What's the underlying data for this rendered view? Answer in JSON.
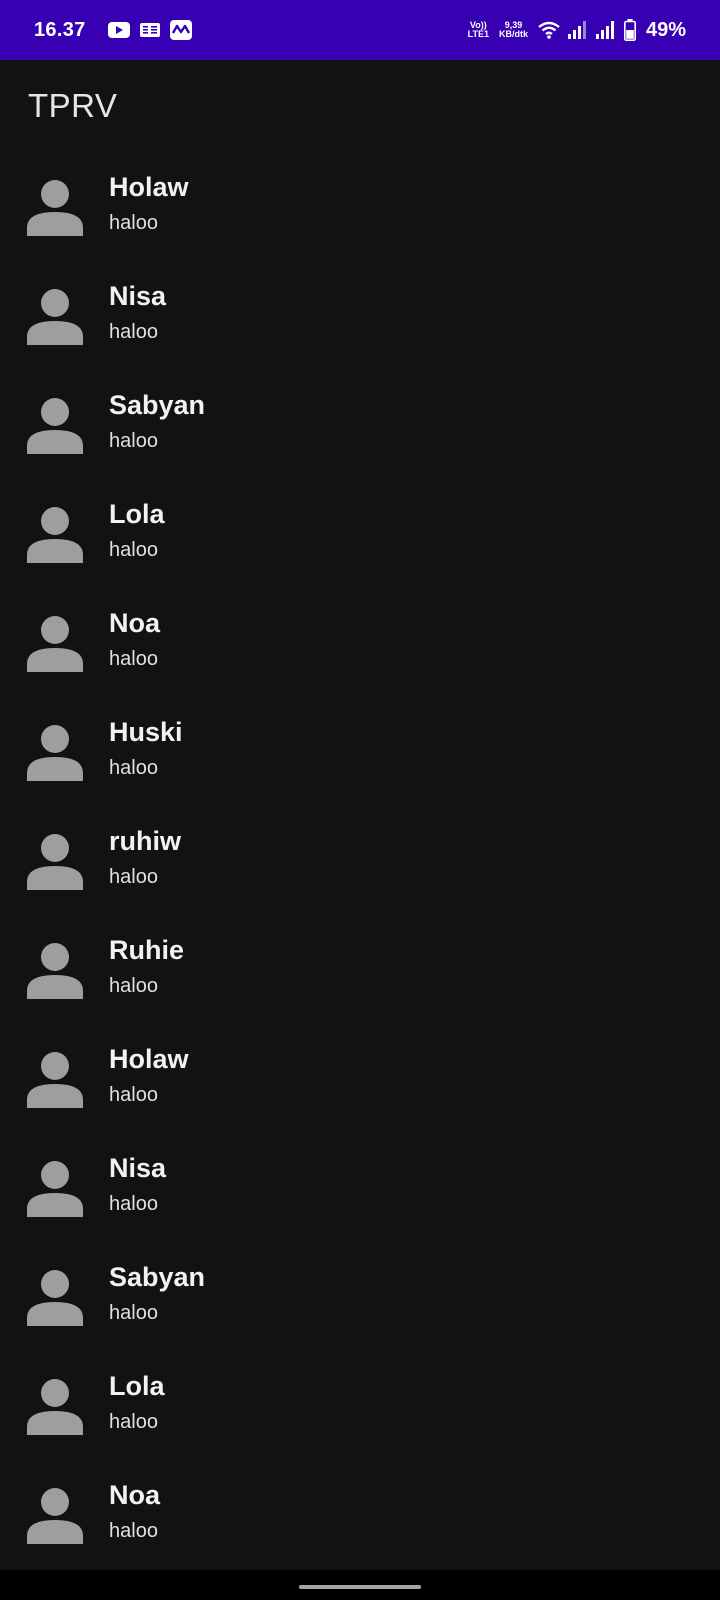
{
  "status_bar": {
    "time": "16.37",
    "notification_icons": [
      "youtube-icon",
      "ge-icon",
      "mail-icon"
    ],
    "volte_line1": "Vo))",
    "volte_line2": "LTE1",
    "speed_value": "9,39",
    "speed_unit": "KB/dtk",
    "battery_percent": "49%",
    "background_color": "#3700b3"
  },
  "app_bar": {
    "title": "TPRV"
  },
  "contacts": [
    {
      "name": "Holaw",
      "message": "haloo"
    },
    {
      "name": "Nisa",
      "message": "haloo"
    },
    {
      "name": "Sabyan",
      "message": "haloo"
    },
    {
      "name": "Lola",
      "message": "haloo"
    },
    {
      "name": "Noa",
      "message": "haloo"
    },
    {
      "name": "Huski",
      "message": "haloo"
    },
    {
      "name": "ruhiw",
      "message": "haloo"
    },
    {
      "name": "Ruhie",
      "message": "haloo"
    },
    {
      "name": "Holaw",
      "message": "haloo"
    },
    {
      "name": "Nisa",
      "message": "haloo"
    },
    {
      "name": "Sabyan",
      "message": "haloo"
    },
    {
      "name": "Lola",
      "message": "haloo"
    },
    {
      "name": "Noa",
      "message": "haloo"
    }
  ],
  "colors": {
    "background": "#121212",
    "avatar": "#9e9e9e"
  }
}
